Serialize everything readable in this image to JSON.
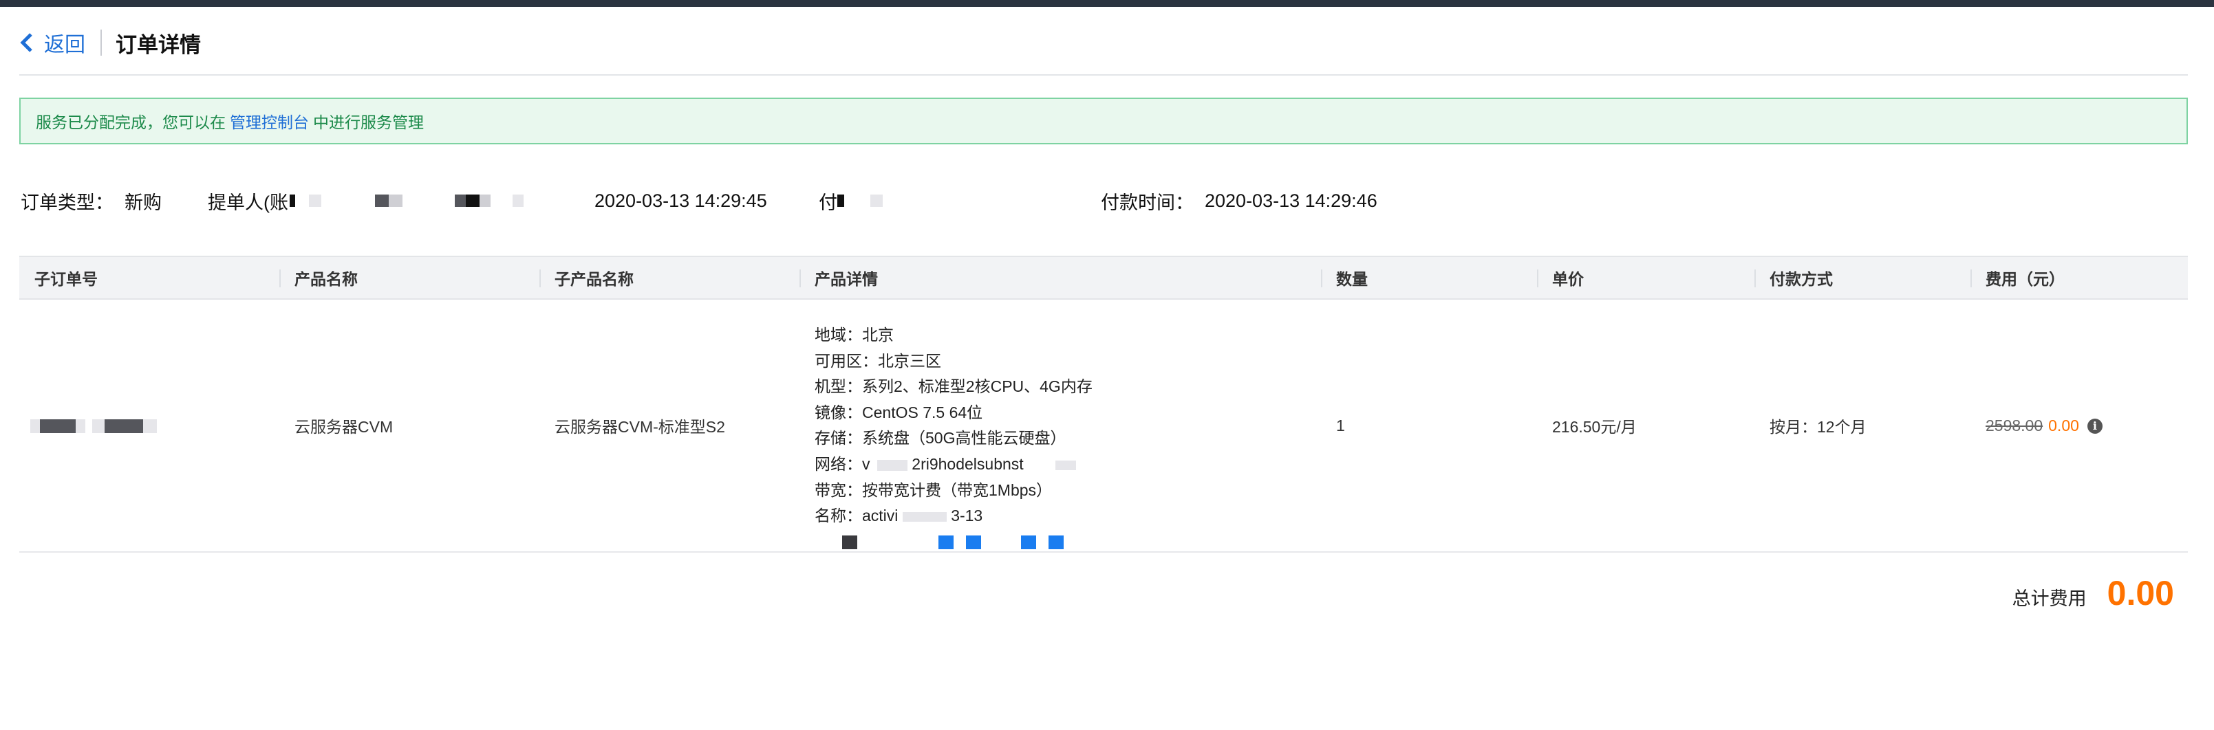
{
  "header": {
    "back_label": "返回",
    "title": "订单详情"
  },
  "notice": {
    "prefix": "服务已分配完成，您可以在",
    "link": "管理控制台",
    "suffix": "中进行服务管理"
  },
  "meta": {
    "order_type_label": "订单类型：",
    "order_type_value": "新购",
    "submitter_label": "提单人(账",
    "create_time_value": "2020-03-13 14:29:45",
    "payer_label": "付",
    "pay_time_label": "付款时间：",
    "pay_time_value": "2020-03-13 14:29:46"
  },
  "table": {
    "headers": [
      "子订单号",
      "产品名称",
      "子产品名称",
      "产品详情",
      "数量",
      "单价",
      "付款方式",
      "费用（元）"
    ],
    "row": {
      "product_name": "云服务器CVM",
      "sub_product_name": "云服务器CVM-标准型S2",
      "details": [
        "地域：北京",
        "可用区：北京三区",
        "机型：系列2、标准型2核CPU、4G内存",
        "镜像：CentOS 7.5 64位",
        "存储：系统盘（50G高性能云硬盘）",
        "网络：v",
        "带宽：按带宽计费（带宽1Mbps）",
        "名称：activi"
      ],
      "network_partial": "2ri9hodelsubnst",
      "name_partial": "3-13",
      "quantity": "1",
      "unit_price": "216.50元/月",
      "payment_method": "按月：12个月",
      "original_price": "2598.00",
      "actual_price": "0.00"
    }
  },
  "total": {
    "label": "总计费用",
    "value": "0.00"
  },
  "colors": {
    "accent_orange": "#ff7200",
    "link_blue": "#1f6fd6",
    "success_green": "#1c8a4a"
  }
}
